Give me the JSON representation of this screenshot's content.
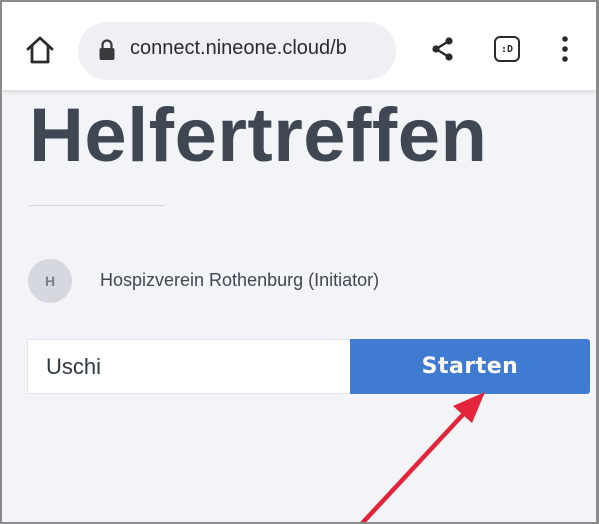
{
  "browser": {
    "url": "connect.nineone.cloud/b",
    "tab_badge": ":D"
  },
  "page": {
    "title": "Helfertreffen",
    "initiator": {
      "avatar_initial": "H",
      "name": "Hospizverein Rothenburg (Initiator)"
    },
    "form": {
      "name_value": "Uschi",
      "start_label": "Starten"
    }
  },
  "colors": {
    "button": "#3f7bd0",
    "annotation_arrow": "#e3243a",
    "page_background": "#f3f4f7"
  }
}
